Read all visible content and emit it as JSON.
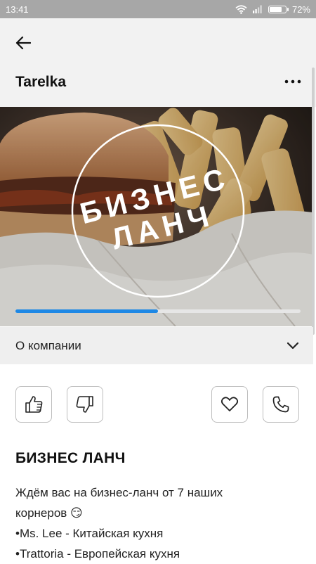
{
  "status_bar": {
    "time": "13:41",
    "battery_percent": "72%"
  },
  "header": {
    "title": "Tarelka"
  },
  "banner": {
    "line1": "БИЗНЕС",
    "line2": "ЛАНЧ",
    "gallery_progress": 0.5
  },
  "about": {
    "label": "О компании"
  },
  "actions": {
    "like": "thumbs-up-icon",
    "dislike": "thumbs-down-icon",
    "favorite": "heart-icon",
    "call": "phone-icon"
  },
  "post": {
    "title": "БИЗНЕС ЛАНЧ",
    "lines": [
      "Ждём вас на бизнес-ланч от 7 наших",
      "корнеров 😏",
      "•Ms. Lee - Китайская кухня",
      "•Trattoria - Европейская кухня"
    ]
  }
}
